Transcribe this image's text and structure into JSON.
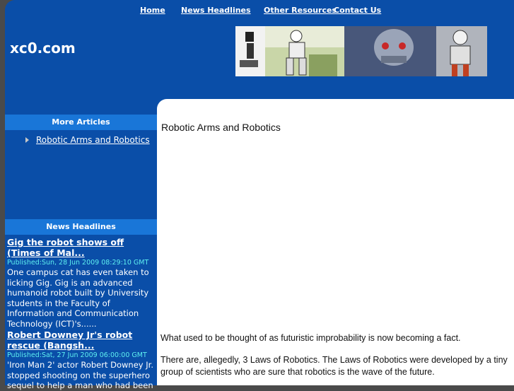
{
  "nav": {
    "home": "Home",
    "news": "News Headlines",
    "resources": "Other Resources",
    "contact": "Contact Us"
  },
  "site": {
    "logo": "xc0.com"
  },
  "sidebar": {
    "articles_heading": "More Articles",
    "articles": [
      "Robotic Arms and Robotics"
    ],
    "news_heading": "News Headlines",
    "news": [
      {
        "title": "Gig the robot shows off (Times of Mal...",
        "published": "Published:Sun, 28 Jun 2009 08:29:10 GMT",
        "summary": "One campus cat has even taken to licking Gig. Gig is an advanced humanoid robot built by University students in the Faculty of Information and Communication Technology (ICT)'s......"
      },
      {
        "title": "Robert Downey Jr's robot rescue (Bangsh...",
        "published": "Published:Sat, 27 Jun 2009 06:00:00 GMT",
        "summary": "'Iron Man 2' actor Robert Downey Jr. stopped shooting on the superhero sequel to help a man who had been"
      }
    ]
  },
  "content": {
    "heading": "Robotic Arms and Robotics",
    "para1": "What used to be thought of as futuristic improbability is now becoming a fact.",
    "para2": "There are, allegedly, 3 Laws of Robotics. The Laws of Robotics were developed by a tiny group of scientists who are sure that robotics is the wave of the future."
  }
}
